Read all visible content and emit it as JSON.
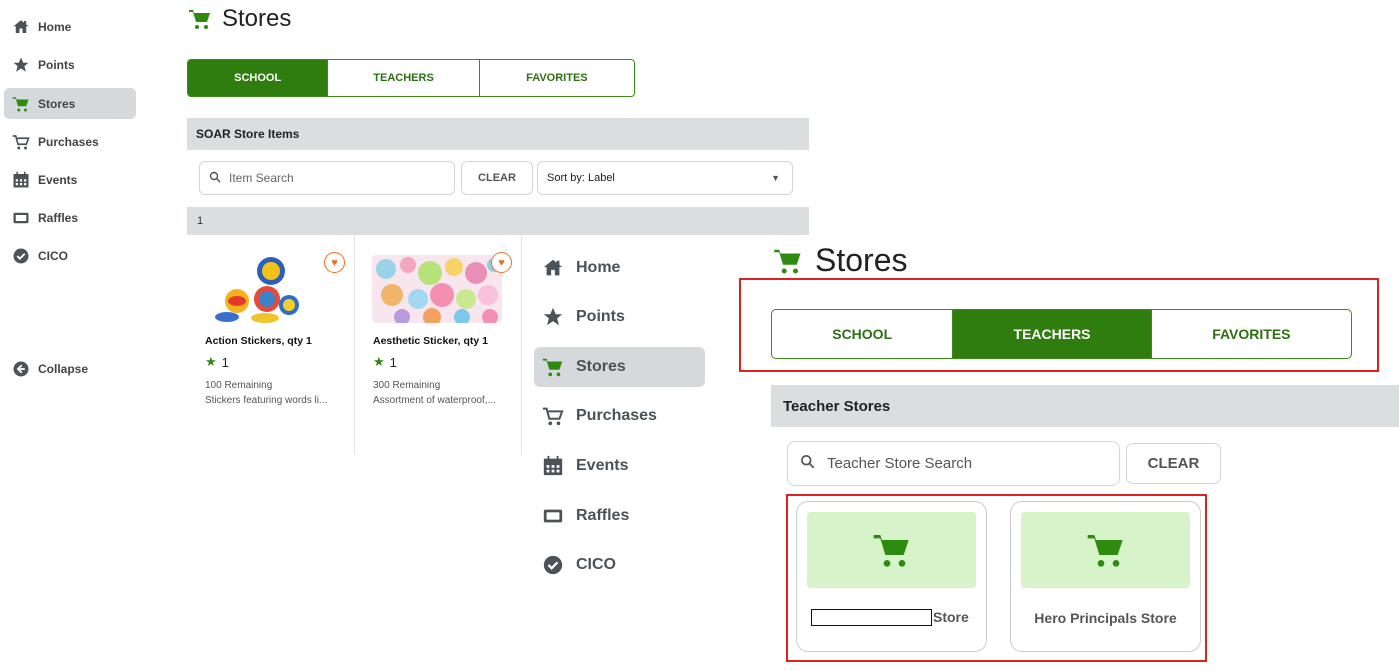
{
  "sidebar_small": {
    "items": [
      {
        "label": "Home",
        "icon": "home-icon"
      },
      {
        "label": "Points",
        "icon": "star-icon"
      },
      {
        "label": "Stores",
        "icon": "cart-icon",
        "active": true
      },
      {
        "label": "Purchases",
        "icon": "cart-outline-icon"
      },
      {
        "label": "Events",
        "icon": "calendar-icon"
      },
      {
        "label": "Raffles",
        "icon": "ticket-icon"
      },
      {
        "label": "CICO",
        "icon": "check-circle-icon"
      }
    ],
    "collapse_label": "Collapse"
  },
  "stores_small": {
    "title": "Stores",
    "tabs": [
      "SCHOOL",
      "TEACHERS",
      "FAVORITES"
    ],
    "active_tab": "SCHOOL",
    "panel_title": "SOAR Store Items",
    "search_placeholder": "Item Search",
    "clear_label": "CLEAR",
    "sort_label": "Sort by: Label",
    "page": "1",
    "items": [
      {
        "name": "Action Stickers, qty 1",
        "points": "1",
        "remaining": "100 Remaining",
        "description": "Stickers featuring words li..."
      },
      {
        "name": "Aesthetic Sticker, qty 1",
        "points": "1",
        "remaining": "300 Remaining",
        "description": "Assortment of waterproof,..."
      }
    ]
  },
  "sidebar_large": {
    "items": [
      {
        "label": "Home",
        "icon": "home-icon"
      },
      {
        "label": "Points",
        "icon": "star-icon"
      },
      {
        "label": "Stores",
        "icon": "cart-icon",
        "active": true
      },
      {
        "label": "Purchases",
        "icon": "cart-outline-icon"
      },
      {
        "label": "Events",
        "icon": "calendar-icon"
      },
      {
        "label": "Raffles",
        "icon": "ticket-icon"
      },
      {
        "label": "CICO",
        "icon": "check-circle-icon"
      }
    ]
  },
  "stores_large": {
    "title": "Stores",
    "tabs": [
      "SCHOOL",
      "TEACHERS",
      "FAVORITES"
    ],
    "active_tab": "TEACHERS",
    "panel_title": "Teacher Stores",
    "search_placeholder": "Teacher Store Search",
    "clear_label": "CLEAR",
    "stores": [
      {
        "name": "Store",
        "name_redacted": true
      },
      {
        "name": "Hero Principals Store"
      }
    ]
  },
  "colors": {
    "brand_green": "#2f7d0e",
    "icon_green": "#2f8a10",
    "banner_green": "#d6f3c9",
    "highlight_red": "#e02020",
    "heart_orange": "#ef6e2a",
    "panel_gray": "#dadedf"
  }
}
